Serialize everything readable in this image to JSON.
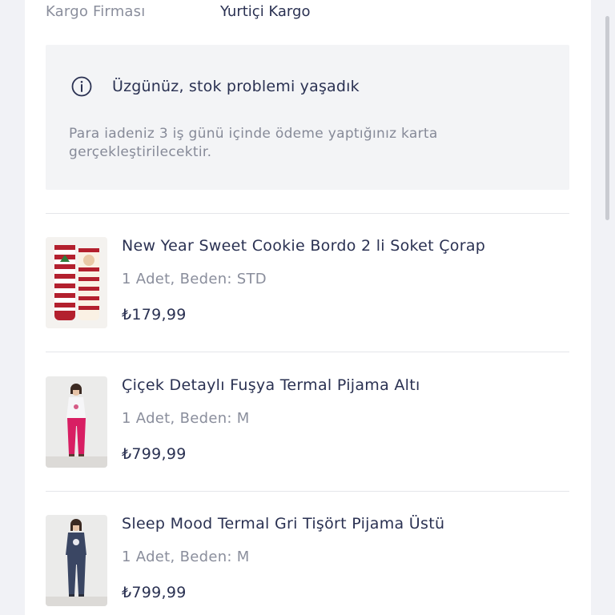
{
  "cargo": {
    "label": "Kargo Firması",
    "value": "Yurtiçi Kargo"
  },
  "notice": {
    "icon": "info-icon",
    "title": "Üzgünüz, stok problemi yaşadık",
    "text": "Para iadeniz 3 iş günü içinde ödeme yaptığınız karta gerçekleştirilecektir."
  },
  "products": [
    {
      "name": "New Year Sweet Cookie Bordo 2 li Soket Çorap",
      "meta": "1 Adet, Beden: STD",
      "price": "₺179,99",
      "image": "socks-thumbnail"
    },
    {
      "name": "Çiçek Detaylı Fuşya Termal Pijama Altı",
      "meta": "1 Adet, Beden: M",
      "price": "₺799,99",
      "image": "pink-pajama-thumbnail"
    },
    {
      "name": "Sleep Mood Termal Gri Tişört Pijama Üstü",
      "meta": "1 Adet, Beden: M",
      "price": "₺799,99",
      "image": "navy-pajama-thumbnail"
    }
  ],
  "colors": {
    "text_primary": "#2a3152",
    "text_muted": "#8a8e9c",
    "notice_bg": "#f3f4f6",
    "page_bg": "#f1f2f6"
  }
}
